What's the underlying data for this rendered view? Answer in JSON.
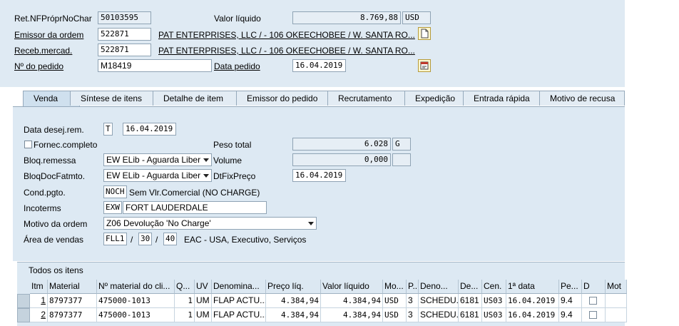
{
  "header": {
    "ret_label": "Ret.NFPróprNoChar",
    "ret_value": "50103595",
    "valor_label": "Valor líquido",
    "valor_value": "8.769,88",
    "valor_currency": "USD",
    "emissor_label": "Emissor da ordem",
    "emissor_value": "522871",
    "emissor_desc": "PAT ENTERPRISES, LLC / - 106 OKEECHOBEE / W. SANTA RO...",
    "receb_label": "Receb.mercad.",
    "receb_value": "522871",
    "receb_desc": "PAT ENTERPRISES, LLC / - 106 OKEECHOBEE / W. SANTA RO...",
    "pedido_label": "Nº do pedido",
    "pedido_value": "M18419",
    "data_pedido_label": "Data pedido",
    "data_pedido_value": "16.04.2019"
  },
  "tabs": [
    {
      "label": "Venda"
    },
    {
      "label": "Síntese de itens"
    },
    {
      "label": "Detalhe de item"
    },
    {
      "label": "Emissor do pedido"
    },
    {
      "label": "Recrutamento"
    },
    {
      "label": "Expedição"
    },
    {
      "label": "Entrada rápida"
    },
    {
      "label": "Motivo de recusa"
    }
  ],
  "venda": {
    "data_desej_label": "Data desej.rem.",
    "data_desej_type": "T",
    "data_desej_value": "16.04.2019",
    "fornec_label": "Fornec.completo",
    "peso_label": "Peso total",
    "peso_value": "6.028",
    "peso_unit": "G",
    "bloq_remessa_label": "Bloq.remessa",
    "bloq_remessa_value": "EW ELib - Aguarda Liber",
    "volume_label": "Volume",
    "volume_value": "0,000",
    "bloq_doc_label": "BloqDocFatmto.",
    "bloq_doc_value": "EW ELib - Aguarda Liber",
    "dtfix_label": "DtFixPreço",
    "dtfix_value": "16.04.2019",
    "cond_label": "Cond.pgto.",
    "cond_value": "NOCH",
    "cond_desc": "Sem Vlr.Comercial (NO CHARGE)",
    "incoterms_label": "Incoterms",
    "incoterms_value": "EXW",
    "incoterms_place": "FORT LAUDERDALE",
    "motivo_label": "Motivo da ordem",
    "motivo_value": "Z06 Devolução 'No Charge'",
    "area_label": "Área de vendas",
    "area_org": "FLL1",
    "area_sep1": "/",
    "area_canal": "30",
    "area_sep2": "/",
    "area_setor": "40",
    "area_desc": "EAC - USA, Executivo, Serviços"
  },
  "items": {
    "section_title": "Todos os itens",
    "columns": [
      "Itm",
      "Material",
      "Nº material do cli...",
      "Q...",
      "UV",
      "Denomina...",
      "Preço líq.",
      "Valor líquido",
      "Mo...",
      "P..",
      "Deno...",
      "De...",
      "Cen.",
      "1ª data",
      "Pe...",
      "D",
      "Mot"
    ],
    "rows": [
      [
        "1",
        "8797377",
        "475000-1013",
        "1",
        "UM",
        "FLAP ACTU...",
        "4.384,94",
        "4.384,94",
        "USD",
        "3",
        "SCHEDU...",
        "6181",
        "US03",
        "16.04.2019",
        "9.4"
      ],
      [
        "2",
        "8797377",
        "475000-1013",
        "1",
        "UM",
        "FLAP ACTU...",
        "4.384,94",
        "4.384,94",
        "USD",
        "3",
        "SCHEDU...",
        "6181",
        "US03",
        "16.04.2019",
        "9.4"
      ]
    ]
  },
  "icons": {
    "emissor_btn": "document-icon",
    "pedido_btn": "calendar-document-icon"
  }
}
